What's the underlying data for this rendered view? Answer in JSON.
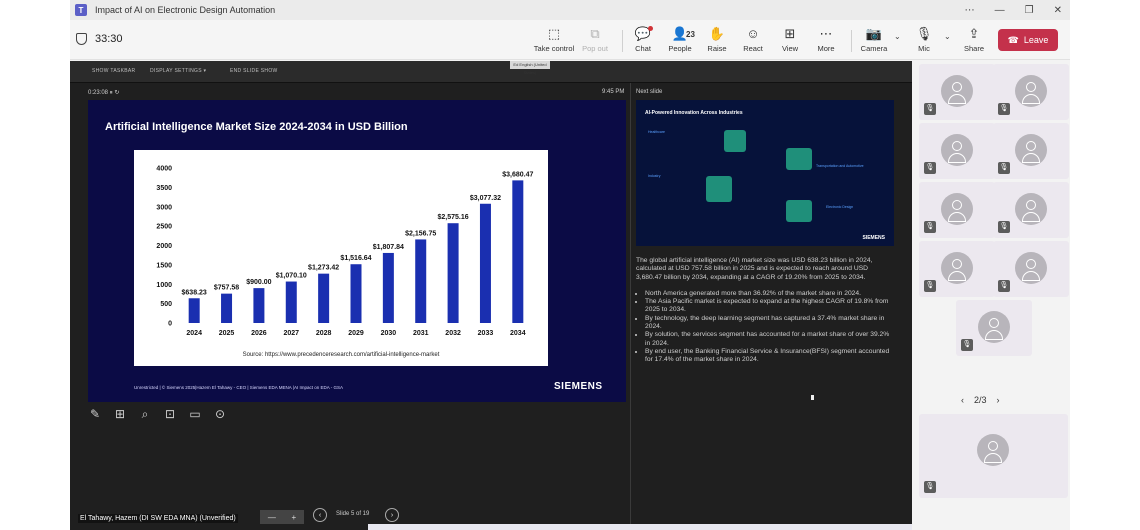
{
  "window": {
    "title": "Impact of AI on Electronic Design Automation",
    "controls": [
      "⋯",
      "—",
      "❐",
      "✕"
    ]
  },
  "meeting": {
    "timer": "33:30",
    "toolbar": {
      "take_control": "Take control",
      "pop_out": "Pop out",
      "chat": "Chat",
      "people": "People",
      "people_count": "23",
      "raise": "Raise",
      "react": "React",
      "view": "View",
      "more": "More",
      "camera": "Camera",
      "mic": "Mic",
      "share": "Share",
      "leave": "Leave"
    }
  },
  "presenter": {
    "top_items": [
      "SHOW TASKBAR",
      "DISPLAY SETTINGS ▾",
      "END SLIDE SHOW"
    ],
    "language_tag": "Ed English (United States)",
    "elapsed": "0:23:08",
    "clock": "9:45 PM",
    "next_slide_label": "Next slide",
    "slide_counter": "Slide 5 of 19",
    "speaker_name": "El Tahawy, Hazem (DI SW EDA MNA) (Unverified)"
  },
  "slide": {
    "title": "Artificial Intelligence Market Size 2024-2034 in USD Billion",
    "footer": "Unrestricted | © Siemens 2025|Hazem El Tahawy - CEO | Siemens EDA MENA |AI Impact on EDA - GSA",
    "logo": "SIEMENS"
  },
  "chart_data": {
    "type": "bar",
    "title": "",
    "categories": [
      "2024",
      "2025",
      "2026",
      "2027",
      "2028",
      "2029",
      "2030",
      "2031",
      "2032",
      "2033",
      "2034"
    ],
    "values": [
      638.23,
      757.58,
      900.0,
      1070.1,
      1273.42,
      1516.64,
      1807.84,
      2156.75,
      2575.16,
      3077.32,
      3680.47
    ],
    "data_labels": [
      "$638.23",
      "$757.58",
      "$900.00",
      "$1,070.10",
      "$1,273.42",
      "$1,516.64",
      "$1,807.84",
      "$2,156.75",
      "$2,575.16",
      "$3,077.32",
      "$3,680.47"
    ],
    "yticks": [
      0,
      500,
      1000,
      1500,
      2000,
      2500,
      3000,
      3500,
      4000
    ],
    "ylim": [
      0,
      4000
    ],
    "xlabel": "",
    "ylabel": "",
    "grid": false,
    "bar_color": "#1a2fb0",
    "source": "Source: https://www.precedenceresearch.com/artificial-intelligence-market"
  },
  "next_slide": {
    "title": "AI-Powered Innovation Across Industries",
    "sections": [
      "Healthcare",
      "Industry",
      "Transportation and Automotive",
      "Electronic Design"
    ],
    "logo": "SIEMENS"
  },
  "notes": {
    "paragraph": "The global artificial intelligence (AI) market size was USD 638.23 billion in 2024, calculated at USD 757.58 billion in 2025 and is expected to reach around USD 3,680.47 billion by 2034, expanding at a CAGR of 19.20% from 2025 to 2034.",
    "bullets": [
      "North America generated more than 36.92% of the market share in 2024.",
      "The Asia Pacific market is expected to expand at the highest CAGR of 19.8% from 2025 to 2034.",
      "By technology, the deep learning segment has captured a 37.4% market share in 2024.",
      "By solution, the services segment has accounted for a market share of over 39.2% in 2024.",
      "By end user, the Banking Financial Service & Insurance(BFSI) segment accounted for 17.4% of the market share in 2024."
    ]
  },
  "gallery": {
    "pager": "2/3",
    "tile_count": 9
  },
  "colors": {
    "leave": "#c4314b",
    "slide_bg": "#0b0b45",
    "stage_bg": "#1f1f1f"
  }
}
